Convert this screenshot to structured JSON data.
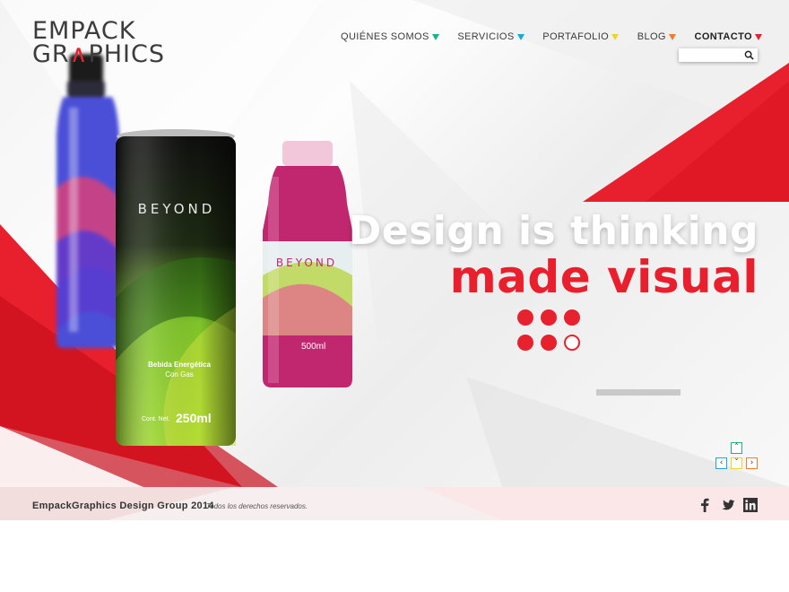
{
  "brand": {
    "logo_line1": "EMPACK",
    "logo_line2_pre": "GR",
    "logo_line2_accent": "∧",
    "logo_line2_post": "PHICS"
  },
  "nav": {
    "items": [
      {
        "label": "QUIÉNES SOMOS",
        "color": "#17b38a"
      },
      {
        "label": "SERVICIOS",
        "color": "#18a9d8"
      },
      {
        "label": "PORTAFOLIO",
        "color": "#f2d22a"
      },
      {
        "label": "BLOG",
        "color": "#f17a2b"
      },
      {
        "label": "CONTACTO",
        "color": "#e8212e"
      }
    ]
  },
  "search": {
    "value": "",
    "placeholder": ""
  },
  "hero": {
    "headline_line1": "Design is thinking",
    "headline_line2": "made visual",
    "products": {
      "can_brand": "BEYOND",
      "can_subtitle": "Bebida Energética",
      "can_subtitle2": "Con Gas",
      "can_net": "Cont. Net.",
      "can_volume": "250ml",
      "bottle_brand": "BEYOND",
      "bottle_volume": "500ml"
    },
    "slider": {
      "dot_count": 6,
      "active_dot": 5,
      "progress": 0.0
    }
  },
  "arrows": {
    "up": "˄",
    "down": "˅",
    "left": "‹",
    "right": "›",
    "up_color": "#17b38a",
    "down_color": "#f2d22a",
    "left_color": "#18a9d8",
    "right_color": "#f17a2b"
  },
  "footer": {
    "brand_text": "EmpackGraphics Design Group 2014",
    "rights_text": "Todos los derechos reservados."
  },
  "social": [
    {
      "name": "facebook-icon"
    },
    {
      "name": "twitter-icon"
    },
    {
      "name": "linkedin-icon"
    }
  ],
  "colors": {
    "accent": "#e8212e",
    "text": "#3a3a3a",
    "footer_bg": "#f7efef"
  }
}
